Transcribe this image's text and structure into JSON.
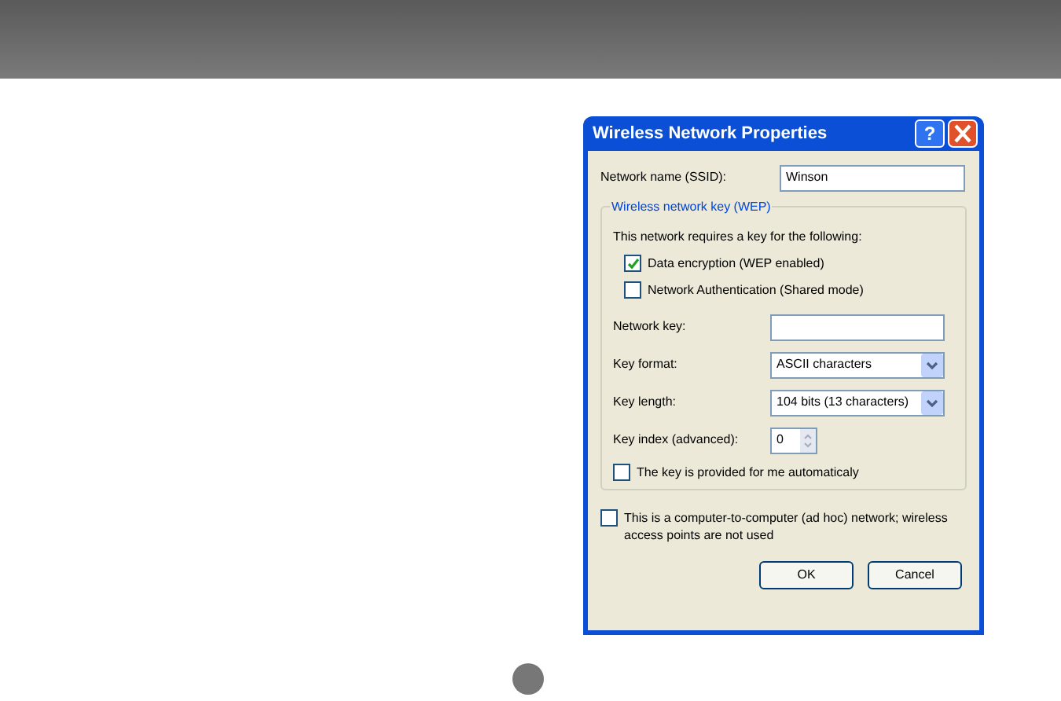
{
  "dialog": {
    "title": "Wireless Network Properties",
    "help_button": "?",
    "ssid": {
      "label": "Network name (SSID):",
      "value": "Winson"
    },
    "wep_group": {
      "title": "Wireless network key (WEP)",
      "intro": "This network requires a key for the following:",
      "options": [
        {
          "label": "Data encryption (WEP enabled)",
          "checked": true
        },
        {
          "label": "Network Authentication (Shared mode)",
          "checked": false
        }
      ],
      "network_key": {
        "label": "Network key:"
      },
      "key_format": {
        "label": "Key format:",
        "value": "ASCII characters"
      },
      "key_length": {
        "label": "Key length:",
        "value": "104 bits (13 characters)"
      },
      "key_index": {
        "label": "Key index (advanced):",
        "value": "0"
      },
      "auto_key": {
        "label": "The key is provided for me automaticaly",
        "checked": false
      }
    },
    "adhoc": {
      "label": "This is a computer-to-computer (ad hoc) network; wireless access points are not used",
      "checked": false
    },
    "buttons": [
      "OK",
      "Cancel"
    ]
  }
}
